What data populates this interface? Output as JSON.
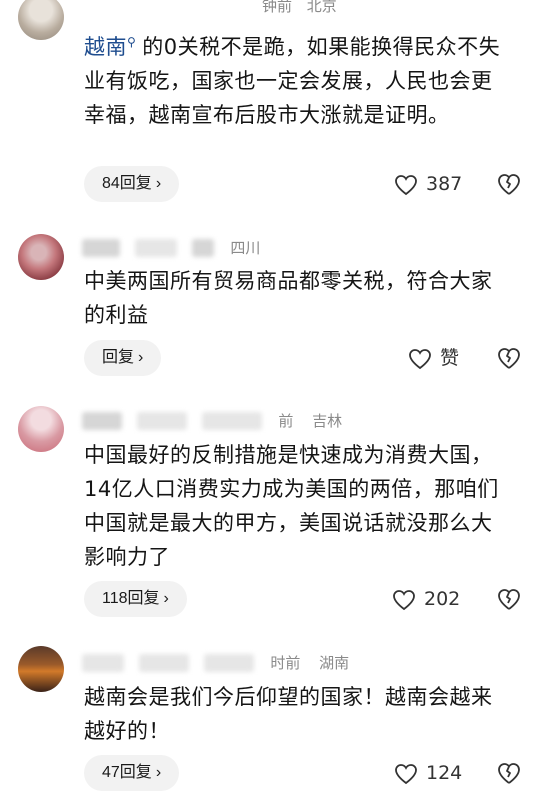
{
  "comments": [
    {
      "time": "钟前",
      "location": "北京",
      "mention": "越南",
      "text": "的0关税不是跪，如果能换得民众不失业有饭吃，国家也一定会发展，人民也会更幸福，越南宣布后股市大涨就是证明。",
      "reply_label": "84回复",
      "like_count": "387"
    },
    {
      "time": "时",
      "location": "四川",
      "text": "中美两国所有贸易商品都零关税，符合大家的利益",
      "reply_label": "回复",
      "like_count": "赞"
    },
    {
      "time": "前",
      "location": "吉林",
      "text": "中国最好的反制措施是快速成为消费大国，14亿人口消费实力成为美国的两倍，那咱们中国就是最大的甲方，美国说话就没那么大影响力了",
      "reply_label": "118回复",
      "like_count": "202"
    },
    {
      "time": "时前",
      "location": "湖南",
      "text": "越南会是我们今后仰望的国家！越南会越来越好的！",
      "reply_label": "47回复",
      "like_count": "124"
    }
  ],
  "icons": {
    "like": "heart-outline-icon",
    "dislike": "broken-heart-icon",
    "reply_chevron": "chevron-right-icon",
    "mention": "search-icon"
  }
}
